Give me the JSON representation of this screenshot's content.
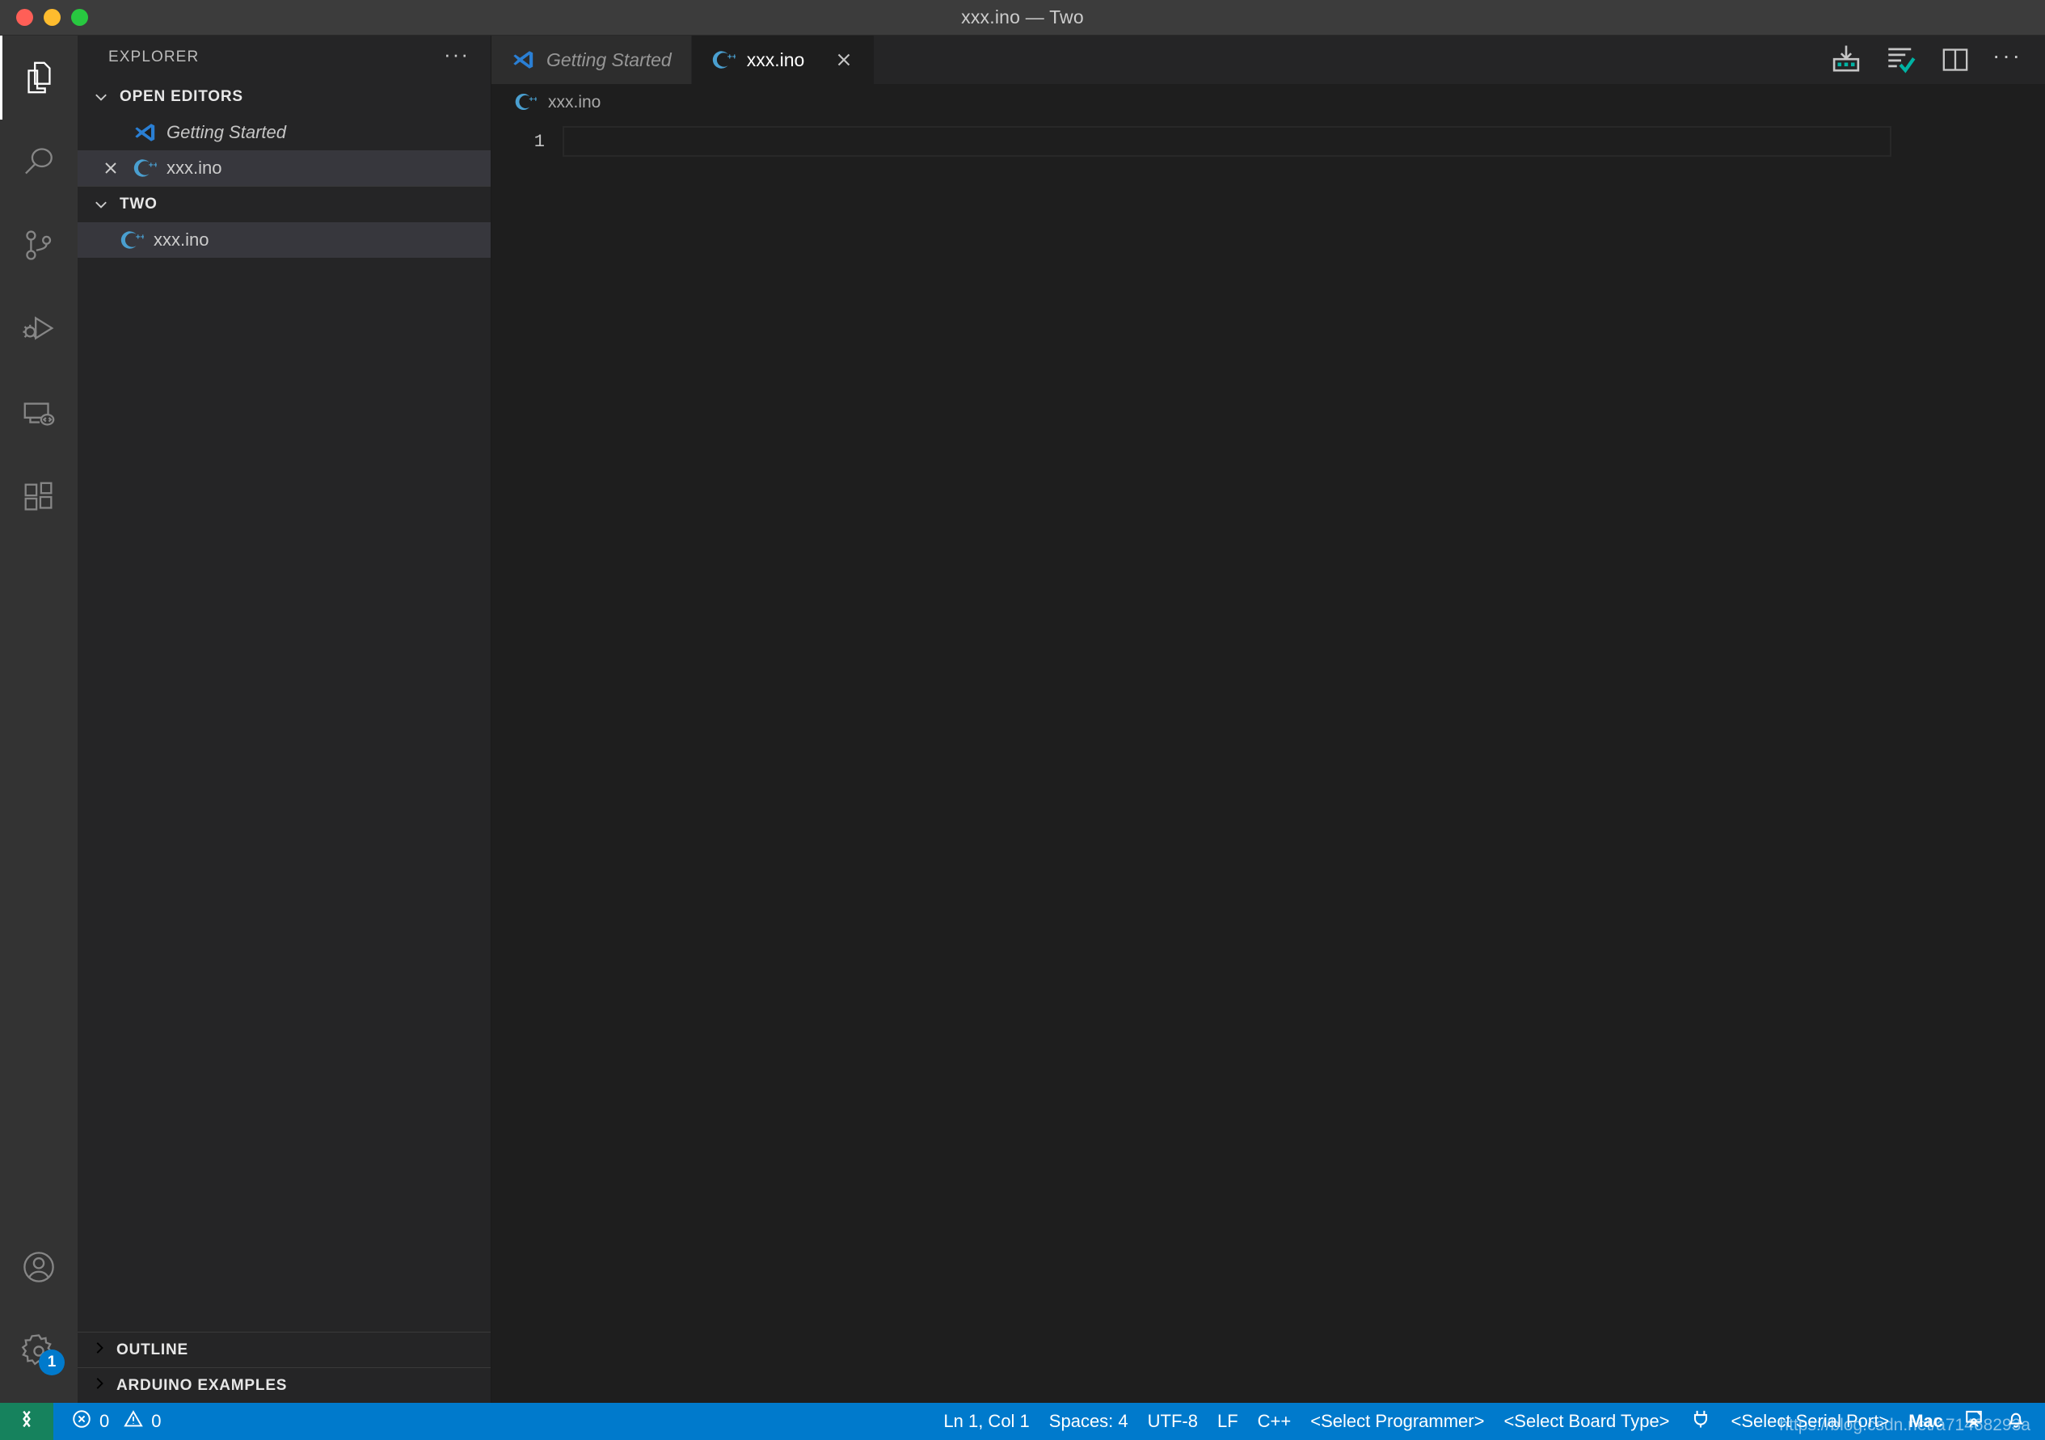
{
  "window": {
    "title": "xxx.ino — Two",
    "traffic_lights": [
      "close-red",
      "minimize-yellow",
      "maximize-green"
    ]
  },
  "activitybar": {
    "items": [
      {
        "name": "explorer",
        "icon": "files-icon",
        "active": true
      },
      {
        "name": "search",
        "icon": "search-icon",
        "active": false
      },
      {
        "name": "source-control",
        "icon": "source-control-icon",
        "active": false
      },
      {
        "name": "run-and-debug",
        "icon": "run-debug-icon",
        "active": false
      },
      {
        "name": "remote-explorer",
        "icon": "remote-explorer-icon",
        "active": false
      },
      {
        "name": "extensions",
        "icon": "extensions-icon",
        "active": false
      }
    ],
    "bottom": [
      {
        "name": "accounts",
        "icon": "account-icon",
        "badge": ""
      },
      {
        "name": "manage",
        "icon": "gear-icon",
        "badge": "1"
      }
    ]
  },
  "sidebar": {
    "title": "EXPLORER",
    "more_actions": "···",
    "sections": [
      {
        "label": "OPEN EDITORS",
        "expanded": true
      },
      {
        "label": "TWO",
        "expanded": true
      }
    ],
    "open_editors": [
      {
        "label": "Getting Started",
        "icon": "vscode-logo-icon",
        "italic": true,
        "dirty": false,
        "selected": false,
        "closable": false
      },
      {
        "label": "xxx.ino",
        "icon": "cpp-file-icon",
        "italic": false,
        "dirty": false,
        "selected": true,
        "closable": true
      }
    ],
    "folder_items": [
      {
        "label": "xxx.ino",
        "icon": "cpp-file-icon",
        "selected": true
      }
    ],
    "bottom_panels": [
      {
        "label": "OUTLINE",
        "expanded": false
      },
      {
        "label": "ARDUINO EXAMPLES",
        "expanded": false
      }
    ]
  },
  "editor": {
    "tabs": [
      {
        "label": "Getting Started",
        "icon": "vscode-logo-icon",
        "italic": true,
        "active": false,
        "closable": false
      },
      {
        "label": "xxx.ino",
        "icon": "cpp-file-icon",
        "italic": false,
        "active": true,
        "closable": true
      }
    ],
    "actions": [
      {
        "name": "arduino-upload",
        "icon": "upload-icon"
      },
      {
        "name": "arduino-verify",
        "icon": "verify-icon"
      },
      {
        "name": "split-editor",
        "icon": "split-editor-icon"
      },
      {
        "name": "more-actions",
        "icon": "ellipsis-icon",
        "label": "···"
      }
    ],
    "breadcrumb": {
      "icon": "cpp-file-icon",
      "label": "xxx.ino"
    },
    "line_numbers": [
      "1"
    ],
    "lines": [
      ""
    ]
  },
  "statusbar": {
    "remote": {
      "icon": "remote-icon",
      "label": ""
    },
    "left": [
      {
        "name": "problems",
        "errors_icon": "error-circle-icon",
        "errors": "0",
        "warnings_icon": "warning-triangle-icon",
        "warnings": "0"
      }
    ],
    "right": [
      {
        "name": "cursor-position",
        "label": "Ln 1, Col 1"
      },
      {
        "name": "indentation",
        "label": "Spaces: 4"
      },
      {
        "name": "encoding",
        "label": "UTF-8"
      },
      {
        "name": "eol",
        "label": "LF"
      },
      {
        "name": "language-mode",
        "label": "C++"
      },
      {
        "name": "select-programmer",
        "label": "<Select Programmer>"
      },
      {
        "name": "select-board",
        "label": "<Select Board Type>"
      },
      {
        "name": "serial-plug",
        "label": "",
        "icon": "plug-icon"
      },
      {
        "name": "select-serial-port",
        "label": "<Select Serial Port>"
      },
      {
        "name": "serial-target",
        "label": "Mac"
      },
      {
        "name": "broadcast",
        "label": "",
        "icon": "broadcast-icon"
      },
      {
        "name": "notifications",
        "label": "",
        "icon": "bell-icon"
      }
    ],
    "watermark": "https://blog.csdn.net/a71468293a"
  },
  "colors": {
    "titlebar_bg": "#3c3c3c",
    "activitybar_bg": "#333333",
    "sidebar_bg": "#252526",
    "editor_bg": "#1e1e1e",
    "tab_inactive_bg": "#2d2d2d",
    "tab_active_bg": "#1e1e1e",
    "selection_bg": "#37373d",
    "statusbar_bg": "#007acc",
    "remote_bg": "#16825d",
    "accent_blue": "#007acc",
    "cpp_icon_blue": "#4a9fd0",
    "arduino_teal": "#00b3a4"
  }
}
